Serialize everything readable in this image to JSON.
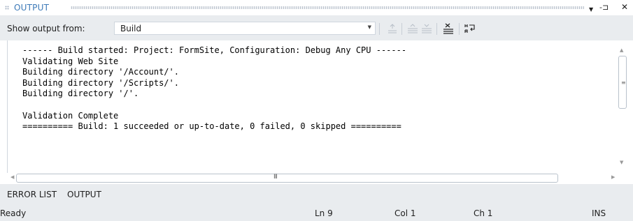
{
  "panel": {
    "title": "OUTPUT",
    "dropdown_glyph": "▼",
    "pin_glyph": "-⊐",
    "close_glyph": "✕"
  },
  "toolbar": {
    "show_output_label": "Show output from:",
    "source_value": "Build",
    "icons": [
      "find-message-in-code-icon",
      "go-to-previous-message-icon",
      "go-to-next-message-icon",
      "clear-all-icon",
      "toggle-word-wrap-icon"
    ]
  },
  "output": {
    "text": "------ Build started: Project: FormSite, Configuration: Debug Any CPU ------\nValidating Web Site\nBuilding directory '/Account/'.\nBuilding directory '/Scripts/'.\nBuilding directory '/'.\n\nValidation Complete\n========== Build: 1 succeeded or up-to-date, 0 failed, 0 skipped =========="
  },
  "scroll": {
    "h_grip": "III"
  },
  "tabs": {
    "error_list": "ERROR LIST",
    "output": "OUTPUT"
  },
  "statusbar": {
    "state": "Ready",
    "line": "Ln 9",
    "col": "Col 1",
    "ch": "Ch 1",
    "mode": "INS"
  },
  "colors": {
    "accent": "#3d7ab8",
    "chrome": "#e9ecef"
  }
}
